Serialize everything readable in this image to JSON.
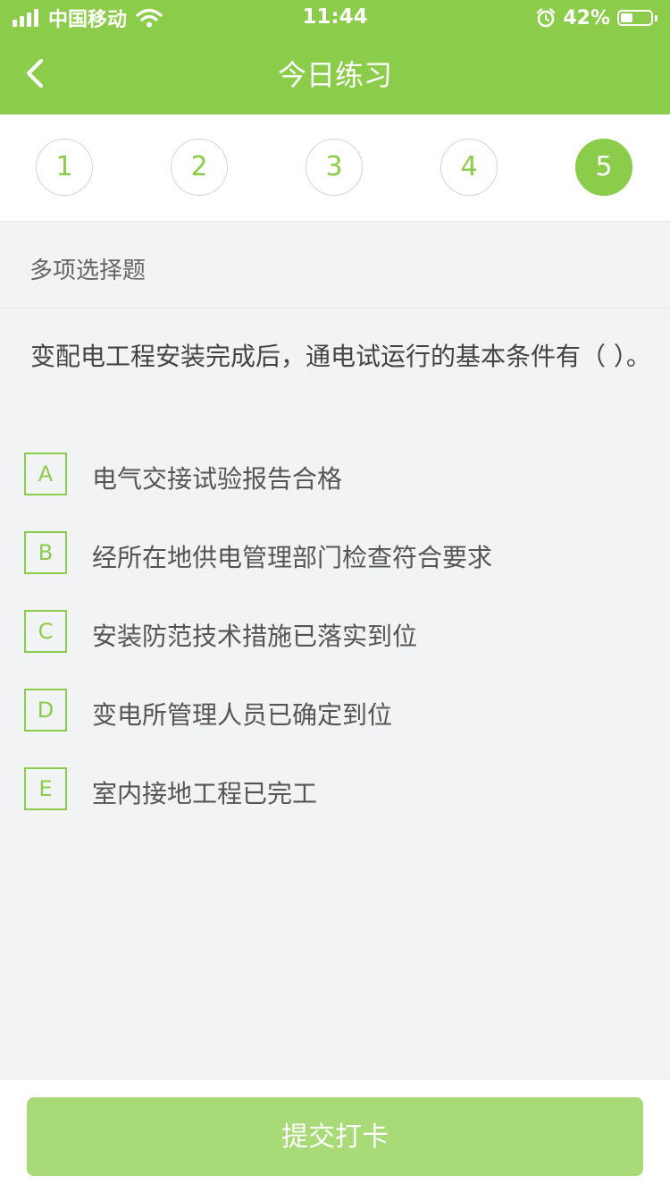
{
  "status_bar": {
    "carrier": "中国移动",
    "time": "11:44",
    "battery_percent": "42%",
    "battery_level": 0.42,
    "icons": [
      "signal-icon",
      "wifi-icon",
      "alarm-icon",
      "battery-icon"
    ]
  },
  "nav": {
    "title": "今日练习",
    "back_icon": "chevron-left-icon"
  },
  "question_nav": {
    "items": [
      {
        "label": "1",
        "active": false
      },
      {
        "label": "2",
        "active": false
      },
      {
        "label": "3",
        "active": false
      },
      {
        "label": "4",
        "active": false
      },
      {
        "label": "5",
        "active": true
      }
    ]
  },
  "question": {
    "type_label": "多项选择题",
    "text": "变配电工程安装完成后，通电试运行的基本条件有（ ）。",
    "options": [
      {
        "letter": "A",
        "text": "电气交接试验报告合格"
      },
      {
        "letter": "B",
        "text": "经所在地供电管理部门检查符合要求"
      },
      {
        "letter": "C",
        "text": "安装防范技术措施已落实到位"
      },
      {
        "letter": "D",
        "text": "变电所管理人员已确定到位"
      },
      {
        "letter": "E",
        "text": "室内接地工程已完工"
      }
    ]
  },
  "footer": {
    "submit_label": "提交打卡"
  },
  "colors": {
    "brand_green": "#8bcc4a",
    "button_green": "#a8da78",
    "background": "#f2f3f5"
  }
}
